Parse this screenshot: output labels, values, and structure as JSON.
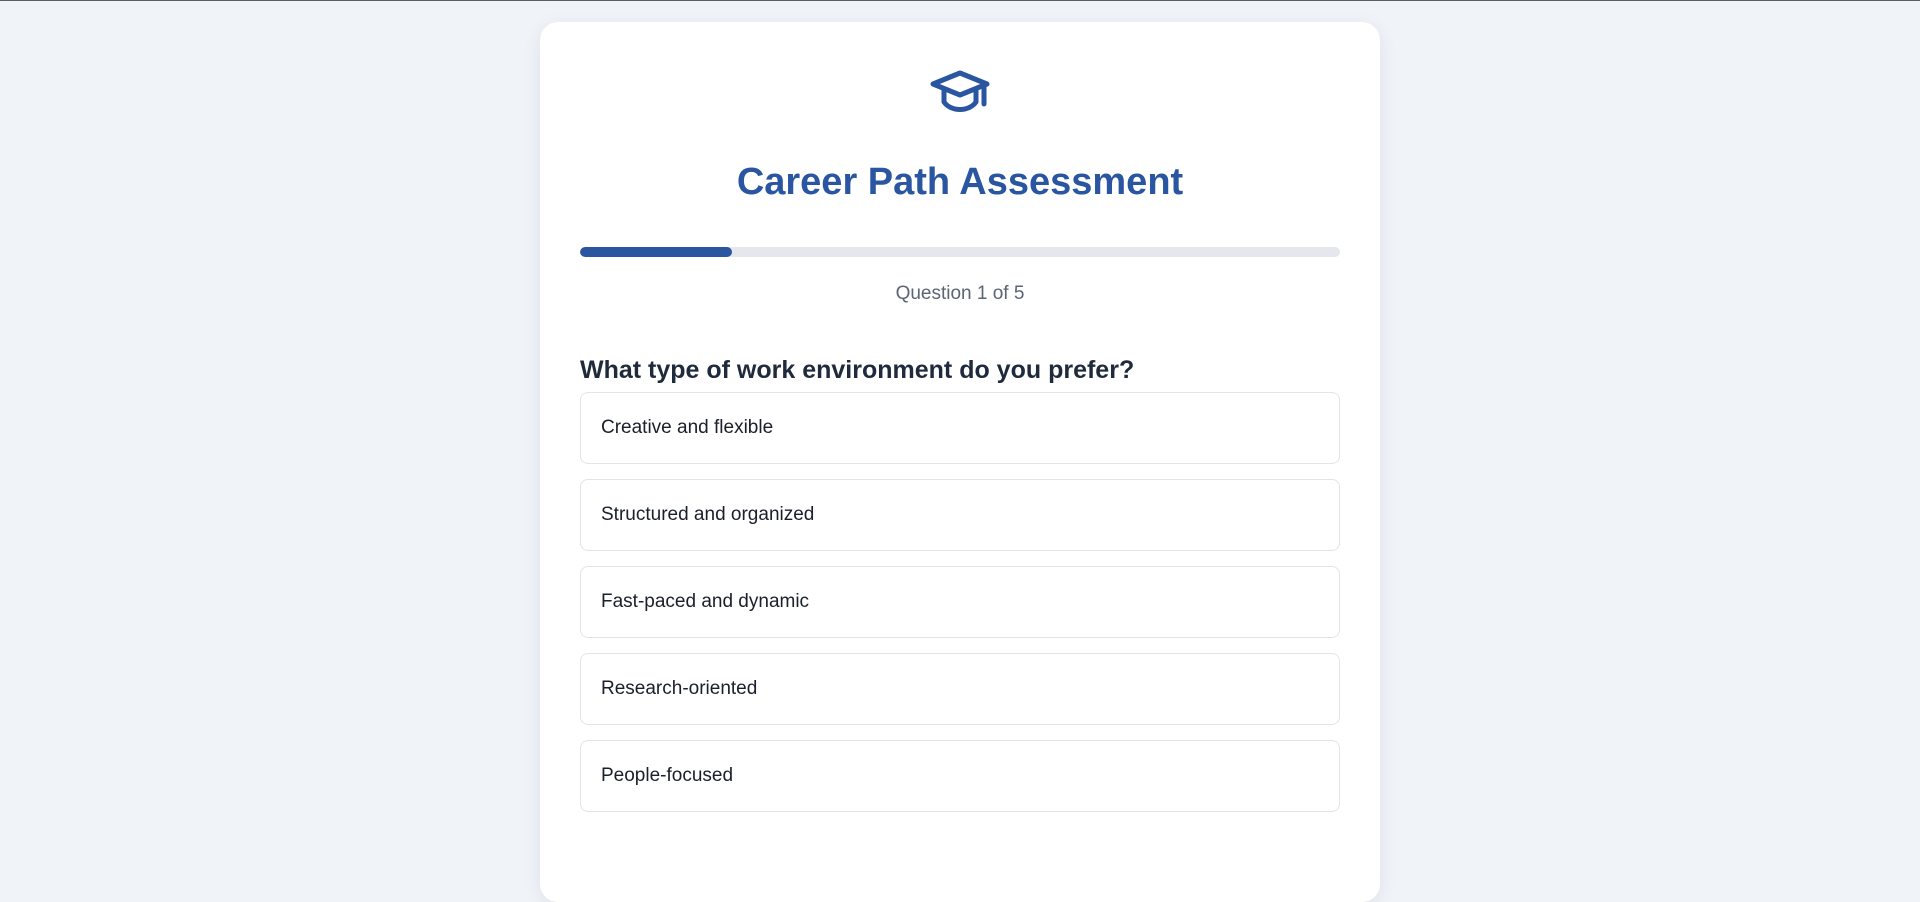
{
  "header": {
    "icon": "graduation-cap-icon",
    "title": "Career Path Assessment"
  },
  "progress": {
    "current": 1,
    "total": 5,
    "fraction": 0.2,
    "label": "Question 1 of 5"
  },
  "question": {
    "text": "What type of work environment do you prefer?",
    "options": [
      "Creative and flexible",
      "Structured and organized",
      "Fast-paced and dynamic",
      "Research-oriented",
      "People-focused"
    ]
  },
  "colors": {
    "accent": "#2a55a0",
    "background": "#f0f3f8",
    "card": "#ffffff",
    "track": "#e5e7ec"
  }
}
